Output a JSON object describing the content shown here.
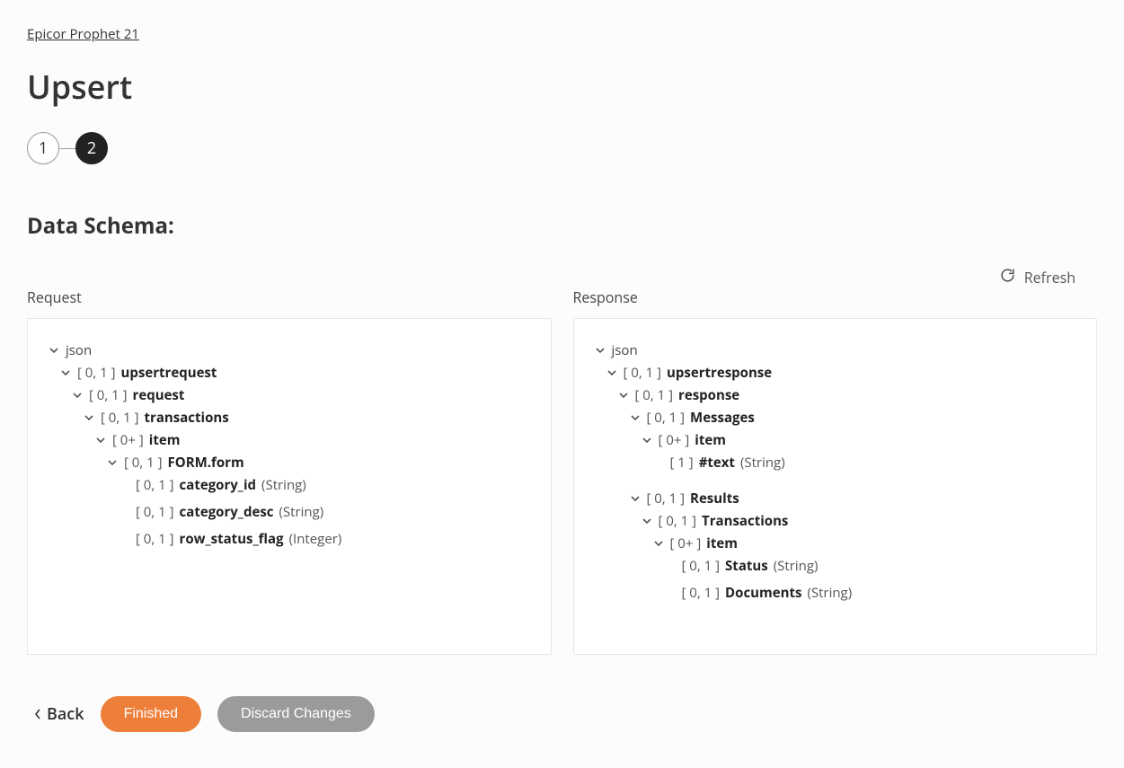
{
  "breadcrumb": "Epicor Prophet 21",
  "title": "Upsert",
  "stepper": {
    "step1": "1",
    "step2": "2"
  },
  "section_title": "Data Schema:",
  "refresh_label": "Refresh",
  "columns": {
    "request_label": "Request",
    "response_label": "Response"
  },
  "request_tree": {
    "root": "json",
    "n1_card": "[ 0, 1 ]",
    "n1_name": "upsertrequest",
    "n2_card": "[ 0, 1 ]",
    "n2_name": "request",
    "n3_card": "[ 0, 1 ]",
    "n3_name": "transactions",
    "n4_card": "[ 0+ ]",
    "n4_name": "item",
    "n5_card": "[ 0, 1 ]",
    "n5_name": "FORM.form",
    "l1_card": "[ 0, 1 ]",
    "l1_name": "category_id",
    "l1_type": "(String)",
    "l2_card": "[ 0, 1 ]",
    "l2_name": "category_desc",
    "l2_type": "(String)",
    "l3_card": "[ 0, 1 ]",
    "l3_name": "row_status_flag",
    "l3_type": "(Integer)"
  },
  "response_tree": {
    "root": "json",
    "n1_card": "[ 0, 1 ]",
    "n1_name": "upsertresponse",
    "n2_card": "[ 0, 1 ]",
    "n2_name": "response",
    "n3_card": "[ 0, 1 ]",
    "n3_name": "Messages",
    "n4_card": "[ 0+ ]",
    "n4_name": "item",
    "l1_card": "[ 1 ]",
    "l1_name": "#text",
    "l1_type": "(String)",
    "n5_card": "[ 0, 1 ]",
    "n5_name": "Results",
    "n6_card": "[ 0, 1 ]",
    "n6_name": "Transactions",
    "n7_card": "[ 0+ ]",
    "n7_name": "item",
    "l2_card": "[ 0, 1 ]",
    "l2_name": "Status",
    "l2_type": "(String)",
    "l3_card": "[ 0, 1 ]",
    "l3_name": "Documents",
    "l3_type": "(String)"
  },
  "footer": {
    "back": "Back",
    "finished": "Finished",
    "discard": "Discard Changes"
  }
}
